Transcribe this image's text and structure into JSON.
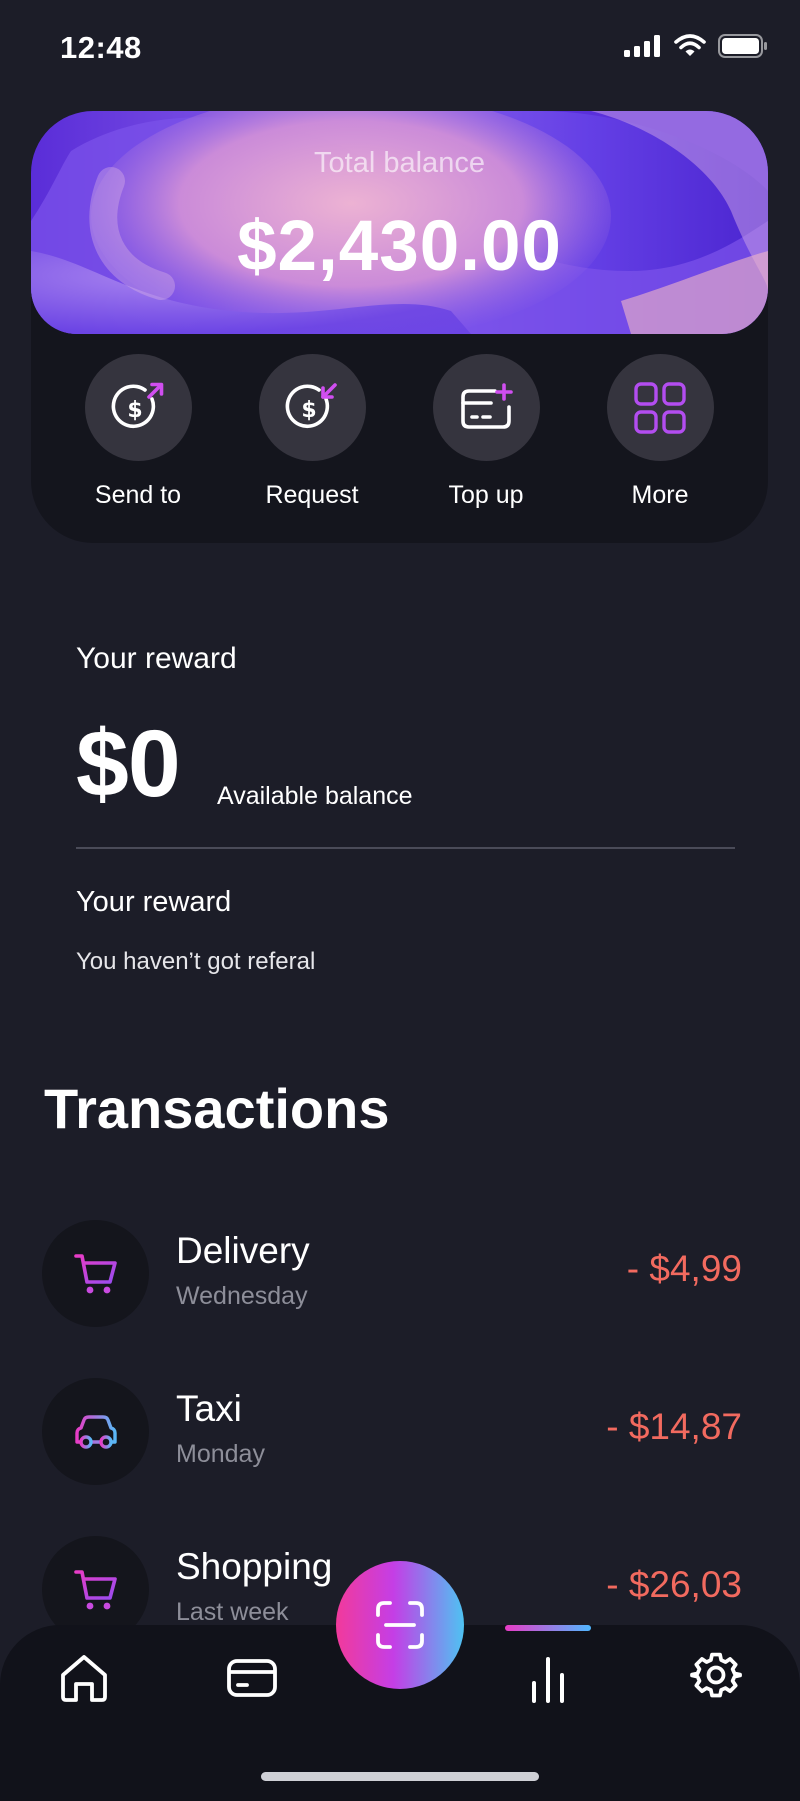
{
  "status_bar": {
    "time": "12:48"
  },
  "balance": {
    "label": "Total balance",
    "amount": "$2,430.00"
  },
  "actions": [
    {
      "label": "Send to",
      "icon": "send-dollar-icon"
    },
    {
      "label": "Request",
      "icon": "request-dollar-icon"
    },
    {
      "label": "Top up",
      "icon": "topup-card-icon"
    },
    {
      "label": "More",
      "icon": "grid-icon"
    }
  ],
  "reward": {
    "title": "Your reward",
    "amount": "$0",
    "amount_caption": "Available balance",
    "section_title": "Your reward",
    "referral_text": "You haven’t got referal"
  },
  "transactions": {
    "header": "Transactions",
    "items": [
      {
        "name": "Delivery",
        "day": "Wednesday",
        "amount": "- $4,99",
        "icon": "cart-icon"
      },
      {
        "name": "Taxi",
        "day": "Monday",
        "amount": "- $14,87",
        "icon": "car-icon"
      },
      {
        "name": "Shopping",
        "day": "Last week",
        "amount": "- $26,03",
        "icon": "cart-icon"
      }
    ]
  },
  "nav": {
    "items": [
      "home-icon",
      "card-icon",
      "scan-icon",
      "stats-icon",
      "settings-icon"
    ],
    "active": "stats-icon"
  },
  "colors": {
    "background": "#1c1d28",
    "accent_pink": "#e83cc6",
    "accent_blue": "#4fb7ff",
    "negative_amount": "#f26a5f"
  }
}
